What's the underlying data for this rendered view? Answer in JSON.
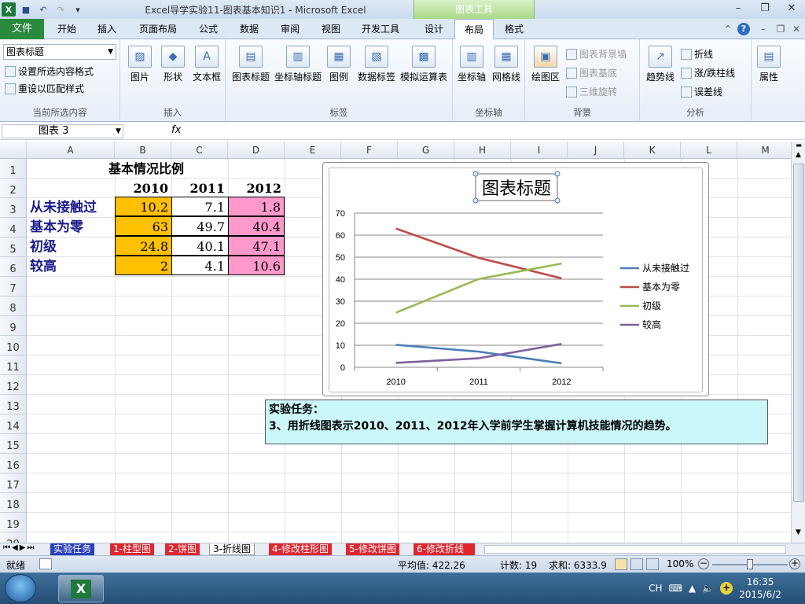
{
  "window": {
    "title": "Excel导学实验11-图表基本知识1  -  Microsoft Excel",
    "context_group": "图表工具"
  },
  "tabs": [
    "文件",
    "开始",
    "插入",
    "页面布局",
    "公式",
    "数据",
    "审阅",
    "视图",
    "开发工具",
    "设计",
    "布局",
    "格式"
  ],
  "active_tab": "布局",
  "ribbon": {
    "current_selection": {
      "dropdown": "图表标题",
      "format_btn": "设置所选内容格式",
      "reset_btn": "重设以匹配样式",
      "label": "当前所选内容"
    },
    "insert": {
      "picture": "图片",
      "shapes": "形状",
      "textbox": "文本框",
      "label": "插入"
    },
    "labels": {
      "chart_title": "图表标题",
      "axis_titles": "坐标轴标题",
      "legend": "图例",
      "data_labels": "数据标签",
      "data_table": "模拟运算表",
      "label": "标签"
    },
    "axes": {
      "axes": "坐标轴",
      "gridlines": "网格线",
      "label": "坐标轴"
    },
    "background": {
      "plot_area": "绘图区",
      "chart_wall": "图表背景墙",
      "chart_floor": "图表基底",
      "rotation": "三维旋转",
      "label": "背景"
    },
    "analysis": {
      "trendline": "趋势线",
      "lines": "折线",
      "updown": "涨/跌柱线",
      "errorbars": "误差线",
      "label": "分析"
    },
    "properties": {
      "label": "属性"
    }
  },
  "formula_bar": {
    "name_box": "图表 3",
    "fx": "fx",
    "formula": ""
  },
  "columns": [
    "A",
    "B",
    "C",
    "D",
    "E",
    "F",
    "G",
    "H",
    "I",
    "J",
    "K",
    "L",
    "M"
  ],
  "rows": [
    "1",
    "2",
    "3",
    "4",
    "5",
    "6",
    "7",
    "8",
    "9",
    "10",
    "11",
    "12",
    "13",
    "14",
    "15",
    "16",
    "17",
    "18",
    "19",
    "20"
  ],
  "table": {
    "title": "基本情况比例",
    "years": [
      "2010",
      "2011",
      "2012"
    ],
    "rows": [
      {
        "label": "从未接触过",
        "values": [
          "10.2",
          "7.1",
          "1.8"
        ]
      },
      {
        "label": "基本为零",
        "values": [
          "63",
          "49.7",
          "40.4"
        ]
      },
      {
        "label": "初级",
        "values": [
          "24.8",
          "40.1",
          "47.1"
        ]
      },
      {
        "label": "较高",
        "values": [
          "2",
          "4.1",
          "10.6"
        ]
      }
    ]
  },
  "chart_data": {
    "type": "line",
    "title": "图表标题",
    "categories": [
      "2010",
      "2011",
      "2012"
    ],
    "ylim": [
      0,
      70
    ],
    "yticks": [
      "0",
      "10",
      "20",
      "30",
      "40",
      "50",
      "60",
      "70"
    ],
    "legend_position": "right",
    "series": [
      {
        "name": "从未接触过",
        "values": [
          10.2,
          7.1,
          1.8
        ],
        "color": "#4a7ebb"
      },
      {
        "name": "基本为零",
        "values": [
          63,
          49.7,
          40.4
        ],
        "color": "#be4b48"
      },
      {
        "name": "初级",
        "values": [
          24.8,
          40.1,
          47.1
        ],
        "color": "#98b954"
      },
      {
        "name": "较高",
        "values": [
          2,
          4.1,
          10.6
        ],
        "color": "#7d60a0"
      }
    ]
  },
  "task": {
    "heading": "实验任务：",
    "text": "3、用折线图表示2010、2011、2012年入学前学生掌握计算机技能情况的趋势。"
  },
  "sheet_tabs": [
    "实验任务",
    "1-柱型图",
    "2-饼图",
    "3-折线图",
    "4-修改柱形图",
    "5-修改饼图",
    "6-修改折线"
  ],
  "active_sheet": "3-折线图",
  "status": {
    "ready": "就绪",
    "average": "平均值: 422.26",
    "count": "计数: 19",
    "sum": "求和: 6333.9",
    "zoom": "100%"
  },
  "taskbar": {
    "lang": "CH",
    "time": "16:35",
    "date": "2015/6/2"
  }
}
